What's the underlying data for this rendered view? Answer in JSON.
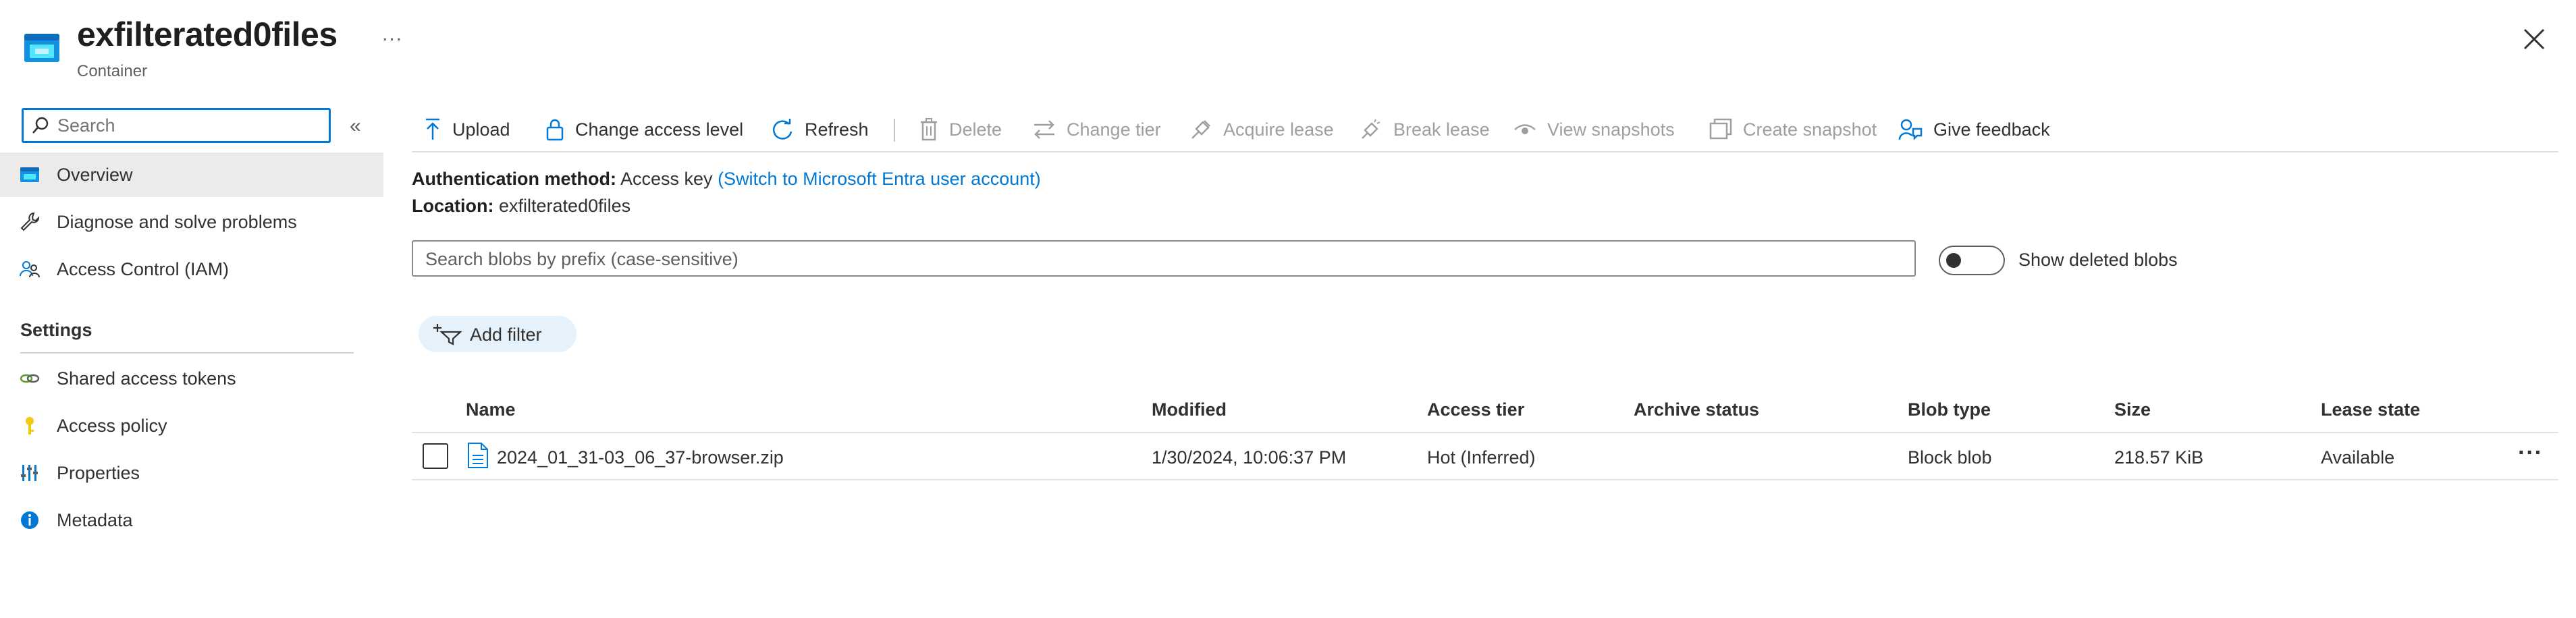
{
  "header": {
    "title": "exfilterated0files",
    "subtitle": "Container",
    "icon": "storage-container-icon",
    "more": "...",
    "close_icon": "close-icon"
  },
  "sidebar": {
    "search_placeholder": "Search",
    "collapse": "«",
    "items": [
      {
        "label": "Overview",
        "icon": "overview-icon",
        "selected": true
      },
      {
        "label": "Diagnose and solve problems",
        "icon": "wrench-icon"
      },
      {
        "label": "Access Control (IAM)",
        "icon": "people-icon"
      }
    ],
    "sections": [
      {
        "title": "Settings",
        "items": [
          {
            "label": "Shared access tokens",
            "icon": "link-icon"
          },
          {
            "label": "Access policy",
            "icon": "key-icon"
          },
          {
            "label": "Properties",
            "icon": "properties-icon"
          },
          {
            "label": "Metadata",
            "icon": "info-icon"
          }
        ]
      }
    ]
  },
  "toolbar": {
    "upload": "Upload",
    "change_access_level": "Change access level",
    "refresh": "Refresh",
    "delete": "Delete",
    "change_tier": "Change tier",
    "acquire_lease": "Acquire lease",
    "break_lease": "Break lease",
    "view_snapshots": "View snapshots",
    "create_snapshot": "Create snapshot",
    "give_feedback": "Give feedback"
  },
  "info": {
    "auth_label": "Authentication method:",
    "auth_value": "Access key",
    "auth_link": "(Switch to Microsoft Entra user account)",
    "location_label": "Location:",
    "location_value": "exfilterated0files"
  },
  "blob_search": {
    "placeholder": "Search blobs by prefix (case-sensitive)"
  },
  "show_deleted": {
    "label": "Show deleted blobs",
    "checked": false
  },
  "filter": {
    "label": "Add filter"
  },
  "table": {
    "columns": [
      "Name",
      "Modified",
      "Access tier",
      "Archive status",
      "Blob type",
      "Size",
      "Lease state"
    ],
    "rows": [
      {
        "name": "2024_01_31-03_06_37-browser.zip",
        "modified": "1/30/2024, 10:06:37 PM",
        "access_tier": "Hot (Inferred)",
        "archive_status": "",
        "blob_type": "Block blob",
        "size": "218.57 KiB",
        "lease_state": "Available",
        "more": "···"
      }
    ]
  },
  "colors": {
    "accent": "#0078d4",
    "selected_nav": "#edebe9",
    "filter_pill": "#e6f2fb",
    "disabled_text": "#a19f9d"
  }
}
